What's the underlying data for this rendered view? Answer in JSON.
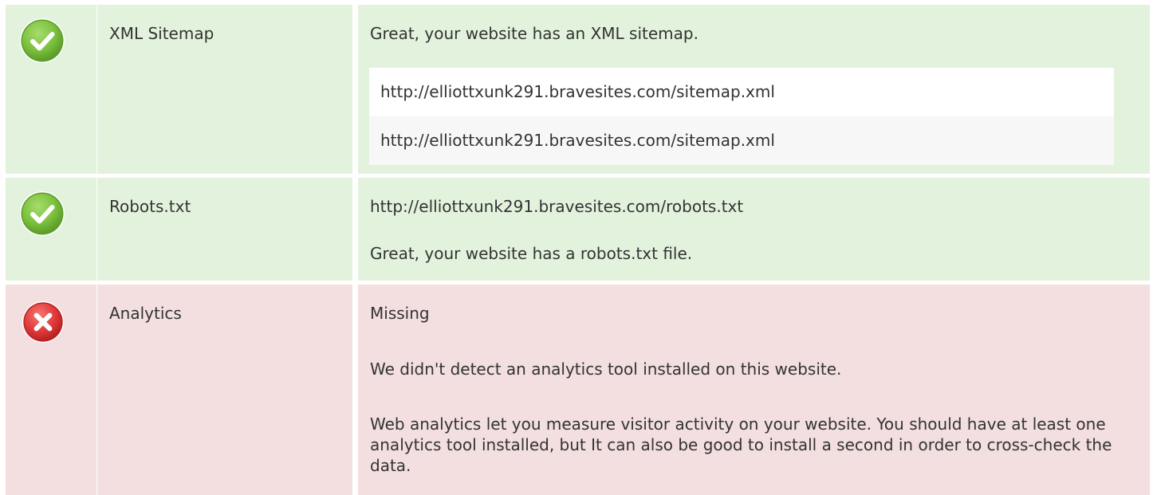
{
  "rows": [
    {
      "status": "pass",
      "status_icon": "check-circle-icon",
      "label": "XML Sitemap",
      "message": "Great, your website has an XML sitemap.",
      "urls": [
        "http://elliottxunk291.bravesites.com/sitemap.xml",
        "http://elliottxunk291.bravesites.com/sitemap.xml"
      ]
    },
    {
      "status": "pass",
      "status_icon": "check-circle-icon",
      "label": "Robots.txt",
      "url": "http://elliottxunk291.bravesites.com/robots.txt",
      "message": "Great, your website has a robots.txt file."
    },
    {
      "status": "fail",
      "status_icon": "error-x-circle-icon",
      "label": "Analytics",
      "status_text": "Missing",
      "message": "We didn't detect an analytics tool installed on this website.",
      "detail": "Web analytics let you measure visitor activity on your website. You should have at least one analytics tool installed, but It can also be good to install a second in order to cross-check the data."
    }
  ],
  "colors": {
    "pass_bg": "#e3f2dc",
    "fail_bg": "#f3dfe0",
    "pass_icon": "#7cc13e",
    "fail_icon": "#e2393c",
    "text": "#333333"
  }
}
